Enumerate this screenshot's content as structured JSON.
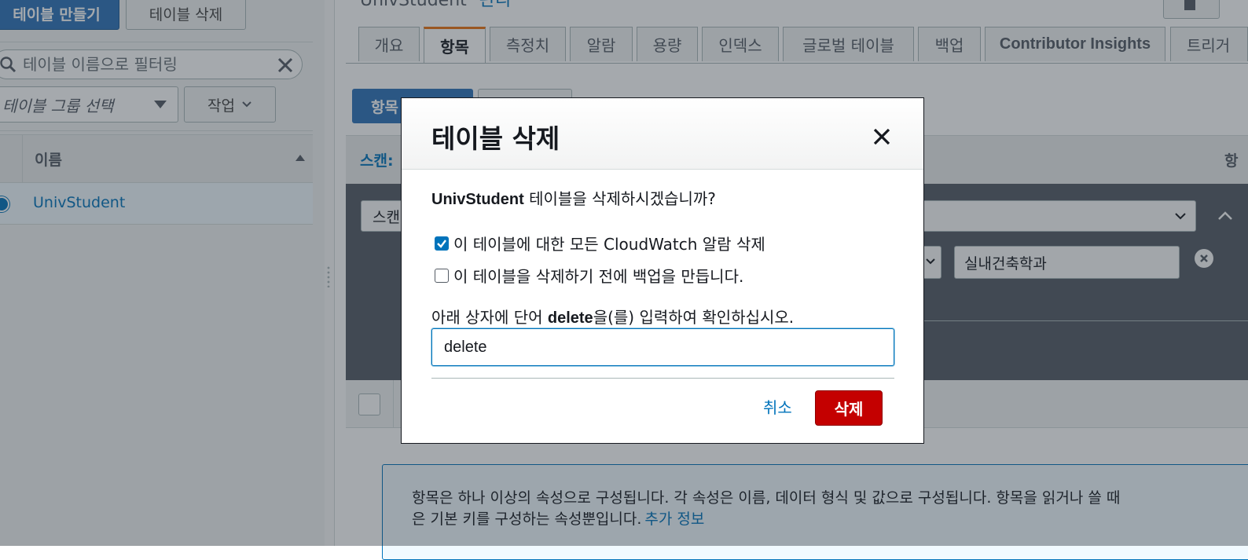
{
  "left_panel": {
    "create_table_label": "테이블 만들기",
    "delete_table_label": "테이블 삭제",
    "filter_placeholder": "테이블 이름으로 필터링",
    "group_select_placeholder": "테이블 그룹 선택",
    "action_label": "작업",
    "column_name": "이름",
    "rows": [
      {
        "name": "UnivStudent",
        "selected": true
      }
    ]
  },
  "right_panel": {
    "title": "UnivStudent",
    "title_sub": "관리",
    "tabs": [
      {
        "label": "개요",
        "active": false
      },
      {
        "label": "항목",
        "active": true
      },
      {
        "label": "측정치",
        "active": false
      },
      {
        "label": "알람",
        "active": false
      },
      {
        "label": "용량",
        "active": false
      },
      {
        "label": "인덱스",
        "active": false
      },
      {
        "label": "글로벌 테이블",
        "active": false
      },
      {
        "label": "백업",
        "active": false
      },
      {
        "label": "Contributor Insights",
        "active": false
      },
      {
        "label": "트리거",
        "active": false
      }
    ],
    "create_item_label": "항목",
    "scan_label": "스캔:",
    "scan_right_label": "항",
    "scan_select_value": "스캔",
    "filter_value": "실내건축학과",
    "info_line1": "항목은 하나 이상의 속성으로 구성됩니다. 각 속성은 이름, 데이터 형식 및 값으로 구성됩니다. 항목을 읽거나 쓸 때",
    "info_line2": "은 기본 키를 구성하는 속성뿐입니다.",
    "info_more": "추가 정보"
  },
  "modal": {
    "title": "테이블 삭제",
    "question_table": "UnivStudent",
    "question_rest": " 테이블을 삭제하시겠습니까?",
    "checkbox_alarms": {
      "label": "이 테이블에 대한 모든 CloudWatch 알람 삭제",
      "checked": true
    },
    "checkbox_backup": {
      "label": "이 테이블을 삭제하기 전에 백업을 만듭니다.",
      "checked": false
    },
    "instruction_before": "아래 상자에 단어 ",
    "instruction_word": "delete",
    "instruction_after": "을(를) 입력하여 확인하십시오.",
    "input_value": "delete",
    "cancel_label": "취소",
    "delete_label": "삭제"
  },
  "colors": {
    "primary_blue": "#2e73b8",
    "link_blue": "#0073bb",
    "danger_red": "#c40000",
    "active_tab_accent": "#ec7211"
  }
}
